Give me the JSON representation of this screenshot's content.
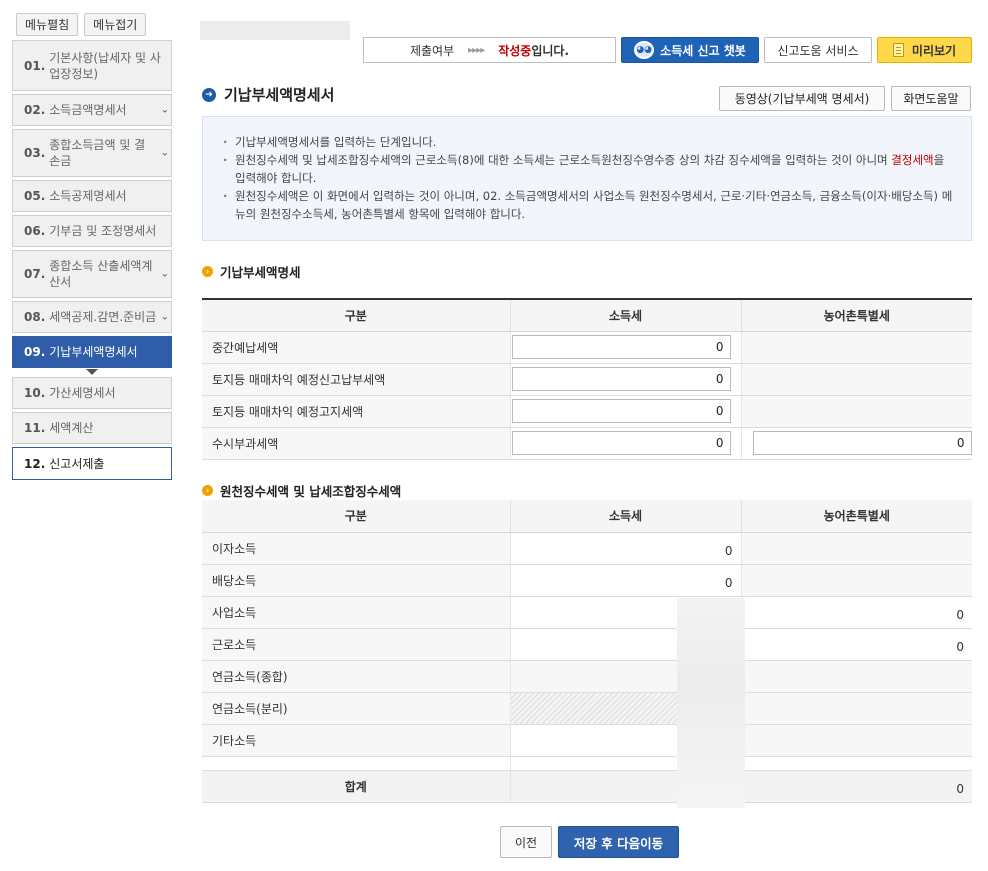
{
  "sidebar": {
    "menu_edit": "메뉴펼침",
    "menu_collapse": "메뉴접기",
    "items": [
      {
        "num": "01.",
        "label": "기본사항(납세자 및 사업장정보)"
      },
      {
        "num": "02.",
        "label": "소득금액명세서"
      },
      {
        "num": "03.",
        "label": "종합소득금액 및 결손금"
      },
      {
        "num": "05.",
        "label": "소득공제명세서"
      },
      {
        "num": "06.",
        "label": "기부금 및 조정명세서"
      },
      {
        "num": "07.",
        "label": "종합소득 산출세액계산서"
      },
      {
        "num": "08.",
        "label": "세액공제.감면.준비금"
      },
      {
        "num": "09.",
        "label": "기납부세액명세서"
      },
      {
        "num": "10.",
        "label": "가산세명세서"
      },
      {
        "num": "11.",
        "label": "세액계산"
      },
      {
        "num": "12.",
        "label": "신고서제출"
      }
    ]
  },
  "topbar": {
    "submit_status_label": "제출여부",
    "arrows": "▸▸▸▸",
    "status_writing": "작성중",
    "status_tail": "입니다.",
    "chatbot": "소득세 신고 챗봇",
    "help_service": "신고도움 서비스",
    "preview": "미리보기"
  },
  "header": {
    "title": "기납부세액명세서",
    "video_button": "동영상(기납부세액 명세서)",
    "screen_help_button": "화면도움말"
  },
  "info": {
    "line1": "기납부세액명세서를 입력하는 단계입니다.",
    "line2_a": "원천징수세액 및 납세조합징수세액의 근로소득(8)에 대한 소득세는 근로소득원천징수영수증 상의 차감 징수세액을 입력하는 것이 아니며 ",
    "line2_red": "결정세액",
    "line2_b": "을 입력해야 합니다.",
    "line3": "원천징수세액은 이 화면에서 입력하는 것이 아니며, 02. 소득금액명세서의 사업소득 원천징수명세서, 근로·기타·연금소득, 금융소득(이자·배당소득) 메뉴의 원천징수소득세, 농어촌특별세 항목에 입력해야 합니다."
  },
  "section1": {
    "title": "기납부세액명세",
    "headers": [
      "구분",
      "소득세",
      "농어촌특별세"
    ],
    "rows": [
      {
        "label": "중간예납세액",
        "income_tax": "0",
        "rural_tax": null
      },
      {
        "label": "토지등 매매차익 예정신고납부세액",
        "income_tax": "0",
        "rural_tax": null
      },
      {
        "label": "토지등 매매차익 예정고지세액",
        "income_tax": "0",
        "rural_tax": null
      },
      {
        "label": "수시부과세액",
        "income_tax": "0",
        "rural_tax": "0"
      }
    ]
  },
  "section2": {
    "title": "원천징수세액 및 납세조합징수세액",
    "headers": [
      "구분",
      "소득세",
      "농어촌특별세"
    ],
    "rows": [
      {
        "label": "이자소득",
        "income_tax": "0",
        "rural_tax": ""
      },
      {
        "label": "배당소득",
        "income_tax": "0",
        "rural_tax": ""
      },
      {
        "label": "사업소득",
        "income_tax": "",
        "rural_tax": "0"
      },
      {
        "label": "근로소득",
        "income_tax": "",
        "rural_tax": "0"
      },
      {
        "label": "연금소득(종합)",
        "income_tax": "",
        "rural_tax": ""
      },
      {
        "label": "연금소득(분리)",
        "income_tax": "",
        "rural_tax": ""
      },
      {
        "label": "기타소득",
        "income_tax": "",
        "rural_tax": ""
      }
    ],
    "total_label": "합계",
    "total_income_tax": "",
    "total_rural_tax": "0"
  },
  "buttons": {
    "prev": "이전",
    "next": "저장 후 다음이동"
  },
  "colors": {
    "primary": "#2f5da8",
    "preview_yellow": "#ffd84a",
    "status_red": "#c00000",
    "section_dot": "#f2a200"
  }
}
